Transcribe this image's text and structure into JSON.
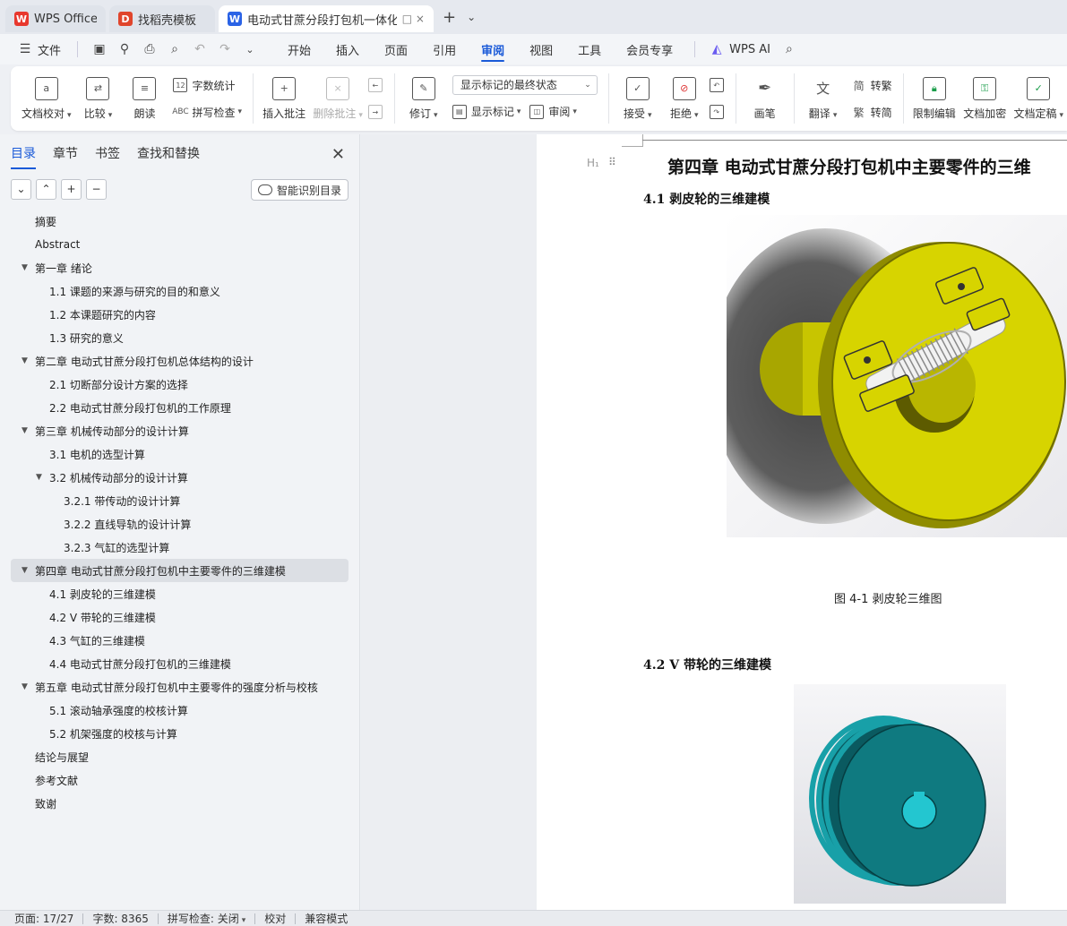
{
  "tabs": [
    {
      "label": "WPS Office",
      "logo": "W",
      "logo_color": "#e8382e",
      "icon": "wps-logo-icon"
    },
    {
      "label": "找稻壳模板",
      "logo": "D",
      "logo_color": "#e0452c",
      "icon": "docer-logo-icon"
    },
    {
      "label": "电动式甘蔗分段打包机一体化",
      "logo": "W",
      "logo_color": "#2b63e6",
      "icon": "writer-logo-icon",
      "extra": "□ ×"
    }
  ],
  "titlebar": {
    "new_tab": "+",
    "tab_list": "⌄"
  },
  "menubar": {
    "file_label": "文件",
    "tabs": [
      "开始",
      "插入",
      "页面",
      "引用",
      "审阅",
      "视图",
      "工具",
      "会员专享"
    ],
    "active_tab": "审阅",
    "ai_label": "WPS AI"
  },
  "ribbon": {
    "proofread": "文档校对",
    "compare": "比较",
    "read_aloud": "朗读",
    "word_count": "字数统计",
    "spell_check": "拼写检查",
    "insert_comment": "插入批注",
    "delete_comment": "删除批注",
    "track_changes": "修订",
    "markup_state": "显示标记的最终状态",
    "show_markup": "显示标记",
    "review": "审阅",
    "accept": "接受",
    "reject": "拒绝",
    "pen": "画笔",
    "translate": "翻译",
    "to_traditional": "转繁",
    "to_simplified": "转简",
    "restrict_edit": "限制编辑",
    "encrypt": "文档加密",
    "finalize": "文档定稿"
  },
  "nav": {
    "tabs": [
      "目录",
      "章节",
      "书签",
      "查找和替换"
    ],
    "active_tab": "目录",
    "tools": [
      "⌄",
      "⌃",
      "+",
      "−"
    ],
    "smart_label": "智能识别目录",
    "toc": [
      {
        "text": "摘要",
        "level": 1,
        "arrow": false
      },
      {
        "text": "Abstract",
        "level": 1,
        "arrow": false
      },
      {
        "text": "第一章 绪论",
        "level": 1,
        "arrow": true
      },
      {
        "text": "1.1 课题的来源与研究的目的和意义",
        "level": 2,
        "arrow": false
      },
      {
        "text": "1.2 本课题研究的内容",
        "level": 2,
        "arrow": false
      },
      {
        "text": "1.3 研究的意义",
        "level": 2,
        "arrow": false
      },
      {
        "text": "第二章 电动式甘蔗分段打包机总体结构的设计",
        "level": 1,
        "arrow": true
      },
      {
        "text": "2.1 切断部分设计方案的选择",
        "level": 2,
        "arrow": false
      },
      {
        "text": "2.2 电动式甘蔗分段打包机的工作原理",
        "level": 2,
        "arrow": false
      },
      {
        "text": "第三章 机械传动部分的设计计算",
        "level": 1,
        "arrow": true
      },
      {
        "text": "3.1 电机的选型计算",
        "level": 2,
        "arrow": false
      },
      {
        "text": "3.2 机械传动部分的设计计算",
        "level": 2,
        "arrow": true
      },
      {
        "text": "3.2.1 带传动的设计计算",
        "level": 3,
        "arrow": false
      },
      {
        "text": "3.2.2 直线导轨的设计计算",
        "level": 3,
        "arrow": false
      },
      {
        "text": "3.2.3 气缸的选型计算",
        "level": 3,
        "arrow": false
      },
      {
        "text": "第四章 电动式甘蔗分段打包机中主要零件的三维建模",
        "level": 1,
        "arrow": true,
        "selected": true
      },
      {
        "text": "4.1 剥皮轮的三维建模",
        "level": 2,
        "arrow": false
      },
      {
        "text": "4.2 V 带轮的三维建模",
        "level": 2,
        "arrow": false
      },
      {
        "text": "4.3 气缸的三维建模",
        "level": 2,
        "arrow": false
      },
      {
        "text": "4.4 电动式甘蔗分段打包机的三维建模",
        "level": 2,
        "arrow": false
      },
      {
        "text": "第五章 电动式甘蔗分段打包机中主要零件的强度分析与校核",
        "level": 1,
        "arrow": true
      },
      {
        "text": "5.1 滚动轴承强度的校核计算",
        "level": 2,
        "arrow": false
      },
      {
        "text": "5.2 机架强度的校核与计算",
        "level": 2,
        "arrow": false
      },
      {
        "text": "结论与展望",
        "level": 1,
        "arrow": false
      },
      {
        "text": "参考文献",
        "level": 1,
        "arrow": false
      },
      {
        "text": "致谢",
        "level": 1,
        "arrow": false
      }
    ]
  },
  "document": {
    "heading_marker": "H₁",
    "chapter_title": "第四章  电动式甘蔗分段打包机中主要零件的三维",
    "section1": "4.1 剥皮轮的三维建模",
    "fig1_caption": "图 4-1  剥皮轮三维图",
    "section2": "4.2 V 带轮的三维建模"
  },
  "status": {
    "page": "页面: 17/27",
    "words": "字数: 8365",
    "spell": "拼写检查: 关闭",
    "proof": "校对",
    "compat": "兼容模式"
  },
  "colors": {
    "accent": "#1a5ad8",
    "wheel_yellow": "#d7d400",
    "pulley_teal": "#0f7a80"
  }
}
